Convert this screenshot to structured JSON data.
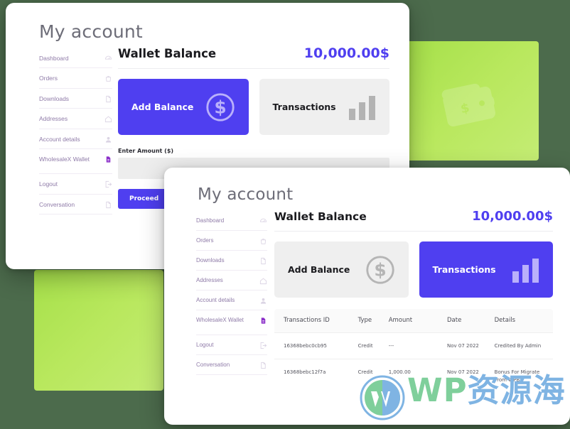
{
  "theme": {
    "background": "#4c6b4c",
    "accent_purple": "#4f3ff0",
    "green_block": "#b9e85e",
    "tile_inactive": "#efefef",
    "sidebar_link": "#8f7ba8"
  },
  "decorations": {
    "green_square_top_right": "green-block",
    "green_square_bottom_left": "green-block",
    "wallet_watermark_icon": "wallet-icon"
  },
  "card_one": {
    "page_title": "My account",
    "sidebar": {
      "items": [
        {
          "label": "Dashboard",
          "icon": "dashboard-icon",
          "active": false
        },
        {
          "label": "Orders",
          "icon": "orders-bag-icon",
          "active": false
        },
        {
          "label": "Downloads",
          "icon": "downloads-file-icon",
          "active": false
        },
        {
          "label": "Addresses",
          "icon": "address-home-icon",
          "active": false
        },
        {
          "label": "Account details",
          "icon": "user-icon",
          "active": false
        },
        {
          "label": "WholesaleX Wallet",
          "icon": "wallet-file-icon",
          "active": true
        },
        {
          "label": "Logout",
          "icon": "logout-icon",
          "active": false
        },
        {
          "label": "Conversation",
          "icon": "conversation-icon",
          "active": false
        }
      ]
    },
    "balance": {
      "title": "Wallet Balance",
      "amount": "10,000.00$"
    },
    "tiles": [
      {
        "label": "Add Balance",
        "icon": "dollar-coin-icon",
        "state": "active"
      },
      {
        "label": "Transactions",
        "icon": "bar-chart-icon",
        "state": "inactive"
      }
    ],
    "form": {
      "amount_label": "Enter Amount ($)",
      "amount_value": "",
      "amount_placeholder": "",
      "proceed_label": "Proceed"
    }
  },
  "card_two": {
    "page_title": "My account",
    "sidebar": {
      "items": [
        {
          "label": "Dashboard",
          "icon": "dashboard-icon",
          "active": false
        },
        {
          "label": "Orders",
          "icon": "orders-bag-icon",
          "active": false
        },
        {
          "label": "Downloads",
          "icon": "downloads-file-icon",
          "active": false
        },
        {
          "label": "Addresses",
          "icon": "address-home-icon",
          "active": false
        },
        {
          "label": "Account details",
          "icon": "user-icon",
          "active": false
        },
        {
          "label": "WholesaleX Wallet",
          "icon": "wallet-file-icon",
          "active": true
        },
        {
          "label": "Logout",
          "icon": "logout-icon",
          "active": false
        },
        {
          "label": "Conversation",
          "icon": "conversation-icon",
          "active": false
        }
      ]
    },
    "balance": {
      "title": "Wallet Balance",
      "amount": "10,000.00$"
    },
    "tiles": [
      {
        "label": "Add Balance",
        "icon": "dollar-coin-icon",
        "state": "inactive"
      },
      {
        "label": "Transactions",
        "icon": "bar-chart-icon",
        "state": "active"
      }
    ],
    "table": {
      "columns": [
        "Transactions ID",
        "Type",
        "Amount",
        "Date",
        "Details"
      ],
      "rows": [
        {
          "id": "16368bebc0cb95",
          "type": "Credit",
          "amount": "---",
          "date": "Nov 07 2022",
          "details": "Credited By Admin"
        },
        {
          "id": "16368bebc12f7a",
          "type": "Credit",
          "amount": "1,000.00",
          "date": "Nov 07 2022",
          "details": "Bonus For Migrate From WPB"
        }
      ]
    }
  },
  "watermark": {
    "logo": "wordpress-logo-icon",
    "text_en": "WP",
    "text_cn": "资源海"
  }
}
